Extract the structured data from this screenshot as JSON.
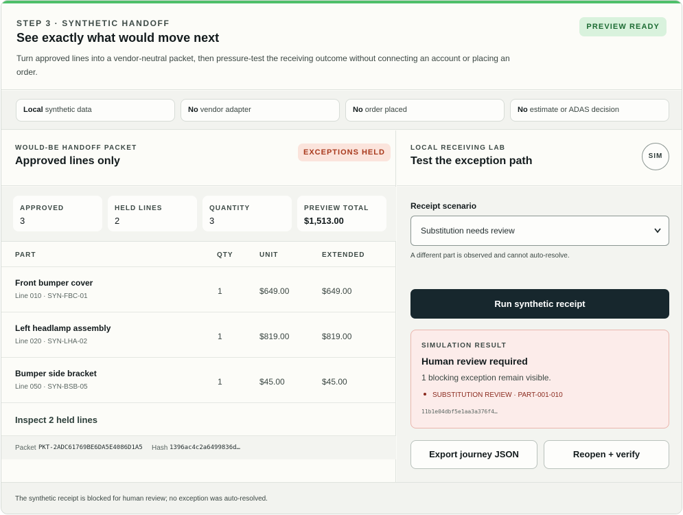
{
  "header": {
    "step": "STEP 3 · SYNTHETIC HANDOFF",
    "title": "See exactly what would move next",
    "description": "Turn approved lines into a vendor-neutral packet, then pressure-test the receiving outcome without connecting an account or placing an order.",
    "status_badge": "PREVIEW READY"
  },
  "chips": [
    {
      "strong": "Local",
      "text": " synthetic data"
    },
    {
      "strong": "No",
      "text": " vendor adapter"
    },
    {
      "strong": "No",
      "text": " order placed"
    },
    {
      "strong": "No",
      "text": " estimate or ADAS decision"
    }
  ],
  "packet_panel": {
    "eyebrow": "WOULD-BE HANDOFF PACKET",
    "title": "Approved lines only",
    "badge": "EXCEPTIONS HELD",
    "stats": [
      {
        "label": "APPROVED",
        "value": "3"
      },
      {
        "label": "HELD LINES",
        "value": "2"
      },
      {
        "label": "QUANTITY",
        "value": "3"
      },
      {
        "label": "PREVIEW TOTAL",
        "value": "$1,513.00"
      }
    ],
    "columns": [
      "PART",
      "QTY",
      "UNIT",
      "EXTENDED"
    ],
    "rows": [
      {
        "name": "Front bumper cover",
        "meta": "Line 010 · SYN-FBC-01",
        "qty": "1",
        "unit": "$649.00",
        "extended": "$649.00"
      },
      {
        "name": "Left headlamp assembly",
        "meta": "Line 020 · SYN-LHA-02",
        "qty": "1",
        "unit": "$819.00",
        "extended": "$819.00"
      },
      {
        "name": "Bumper side bracket",
        "meta": "Line 050 · SYN-BSB-05",
        "qty": "1",
        "unit": "$45.00",
        "extended": "$45.00"
      }
    ],
    "inspect_link": "Inspect 2 held lines",
    "packet_label": "Packet",
    "packet_id": "PKT-2ADC61769BE6DA5E4086D1A5",
    "hash_label": "Hash",
    "hash_value": "1396ac4c2a6499836d…"
  },
  "receiving_lab": {
    "eyebrow": "LOCAL RECEIVING LAB",
    "title": "Test the exception path",
    "badge": "SIM",
    "scenario_label": "Receipt scenario",
    "scenario_selected": "Substitution needs review",
    "scenario_hint": "A different part is observed and cannot auto-resolve.",
    "run_button": "Run synthetic receipt",
    "result": {
      "eyebrow": "SIMULATION RESULT",
      "title": "Human review required",
      "text": "1 blocking exception remain visible.",
      "item": "SUBSTITUTION REVIEW · PART-001-010",
      "hash": "11b1e04dbf5e1aa3a376f4…"
    },
    "export_button": "Export journey JSON",
    "reopen_button": "Reopen + verify"
  },
  "footer": {
    "status": "The synthetic receipt is blocked for human review; no exception was auto-resolved."
  },
  "colors": {
    "accent_top": "#4fbf6a",
    "ready_bg": "#d9f2dd",
    "exception_bg": "#fbe4dc",
    "exception_text": "#a8391c",
    "primary_button": "#17272d",
    "result_bg": "#fcecea"
  }
}
